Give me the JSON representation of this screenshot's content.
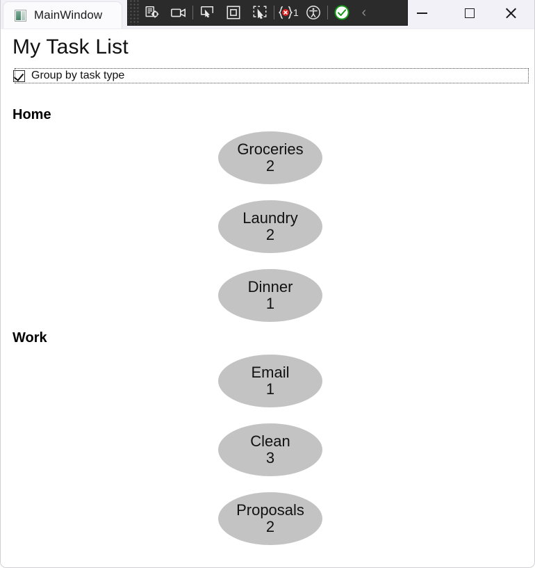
{
  "window": {
    "title": "MainWindow",
    "app_icon": "app-window-icon",
    "controls": {
      "minimize": "minimize-button",
      "maximize": "maximize-button",
      "close": "close-button"
    }
  },
  "cu_toolbar": {
    "grip": "drag-grip",
    "buttons": [
      {
        "name": "screenshot-target-icon",
        "glyph": "screenshot-target"
      },
      {
        "name": "record-video-icon",
        "glyph": "video-camera"
      },
      {
        "name": "cursor-select-icon",
        "glyph": "pointer-screen"
      },
      {
        "name": "window-select-icon",
        "glyph": "square-in-square"
      },
      {
        "name": "element-select-icon",
        "glyph": "pointer-region"
      },
      {
        "name": "error-count-icon",
        "glyph": "error-braces"
      },
      {
        "name": "accessibility-icon",
        "glyph": "accessibility-person"
      },
      {
        "name": "status-ok-icon",
        "glyph": "check-circle"
      }
    ],
    "error_count": "1",
    "collapse_glyph": "‹"
  },
  "app": {
    "page_title": "My Task List",
    "group_by": {
      "label": "Group by task type",
      "checked": true
    },
    "groups": [
      {
        "header": "Home",
        "tasks": [
          {
            "label": "Groceries",
            "count": "2"
          },
          {
            "label": "Laundry",
            "count": "2"
          },
          {
            "label": "Dinner",
            "count": "1"
          }
        ]
      },
      {
        "header": "Work",
        "tasks": [
          {
            "label": "Email",
            "count": "1"
          },
          {
            "label": "Clean",
            "count": "3"
          },
          {
            "label": "Proposals",
            "count": "2"
          }
        ]
      }
    ]
  },
  "colors": {
    "node_fill": "#c3c3c3",
    "titlebar": "#f1f1f7",
    "toolbar": "#2b2b2b",
    "client": "#ffffff",
    "status_ok": "#169616",
    "error_red": "#e02020"
  }
}
